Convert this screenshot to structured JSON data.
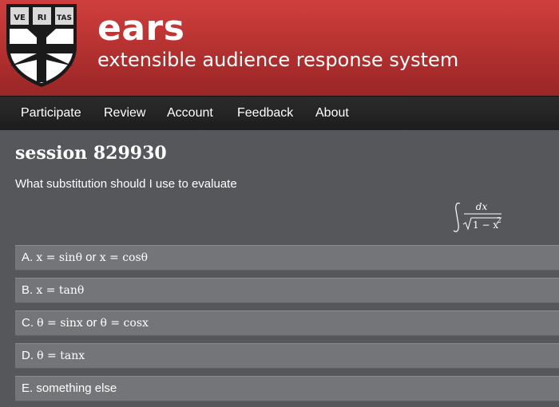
{
  "header": {
    "logo_letters": [
      "VE",
      "RI",
      "TAS"
    ],
    "app_name": "ears",
    "tagline": "extensible audience response system"
  },
  "nav": {
    "items": [
      "Participate",
      "Review",
      "Account",
      "Feedback",
      "About"
    ]
  },
  "session": {
    "title": "session 829930",
    "question": "What substitution should I use to evaluate",
    "formula": {
      "numerator": "dx",
      "radicand": "1 − x",
      "exponent": "2"
    }
  },
  "options": [
    {
      "letter": "A.",
      "parts": [
        "x = sinθ",
        "or",
        "x = cosθ"
      ]
    },
    {
      "letter": "B.",
      "parts": [
        "x = tanθ"
      ]
    },
    {
      "letter": "C.",
      "parts": [
        "θ = sinx",
        "or",
        "θ = cosx"
      ]
    },
    {
      "letter": "D.",
      "parts": [
        "θ = tanx"
      ]
    },
    {
      "letter": "E.",
      "text": "something else"
    }
  ],
  "colors": {
    "header_red": "#b2302f",
    "nav_bg": "#1d1d1d",
    "content_bg": "#55575a",
    "option_bg": "#747578"
  }
}
